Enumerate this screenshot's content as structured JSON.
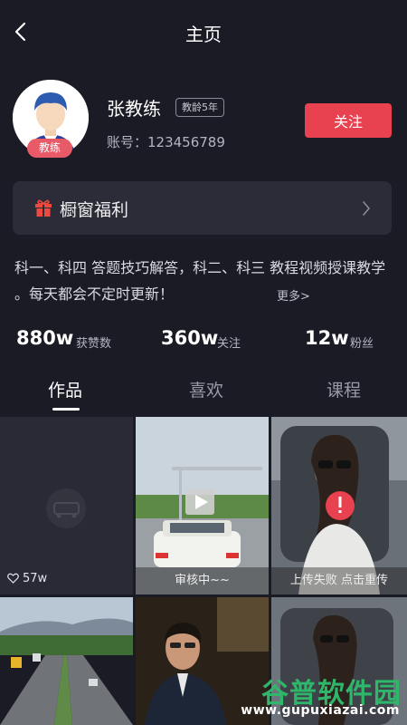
{
  "header": {
    "title": "主页"
  },
  "profile": {
    "avatar_badge": "教练",
    "name": "张教练",
    "years_badge": "教龄5年",
    "account": "账号：123456789",
    "follow_label": "关注"
  },
  "shop": {
    "label": "橱窗福利"
  },
  "bio": {
    "text": "科一、科四 答题技巧解答，科二、科三 教程视频授课教学 。每天都会不定时更新！",
    "more": "更多>"
  },
  "stats": [
    {
      "value": "880w",
      "label": "获赞数"
    },
    {
      "value": "360w",
      "label": "关注"
    },
    {
      "value": "12w",
      "label": "粉丝"
    }
  ],
  "tabs": [
    {
      "label": "作品",
      "active": true
    },
    {
      "label": "喜欢",
      "active": false
    },
    {
      "label": "课程",
      "active": false
    }
  ],
  "videos": [
    {
      "likes": "57w",
      "caption": ""
    },
    {
      "likes": "",
      "caption": "审核中~~"
    },
    {
      "likes": "",
      "caption": "上传失败 点击重传"
    }
  ],
  "watermark": {
    "text": "谷普软件园",
    "url": "www.gupuxiazai.com"
  },
  "colors": {
    "accent": "#e8414f",
    "background": "#1b1b26",
    "card": "#2c2c39",
    "watermark": "#2fb66b"
  }
}
